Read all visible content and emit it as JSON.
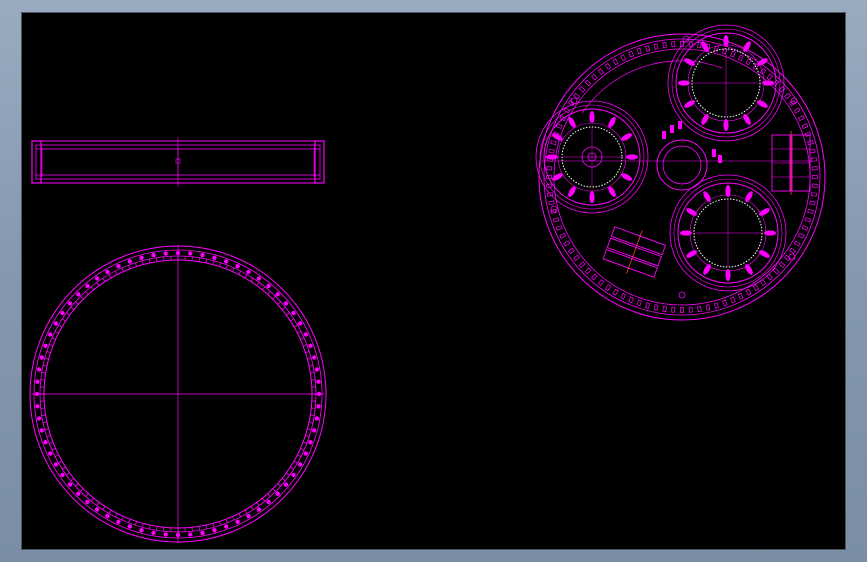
{
  "drawing": {
    "background_color": "#000000",
    "line_color": "#ff00ff",
    "accent_color": "#ff4040",
    "frame_color": "#8a9bb0"
  },
  "views": [
    {
      "name": "side-view",
      "kind": "elevation"
    },
    {
      "name": "ring-plan-view",
      "kind": "plan"
    },
    {
      "name": "assembly-plan-view",
      "kind": "plan"
    }
  ]
}
